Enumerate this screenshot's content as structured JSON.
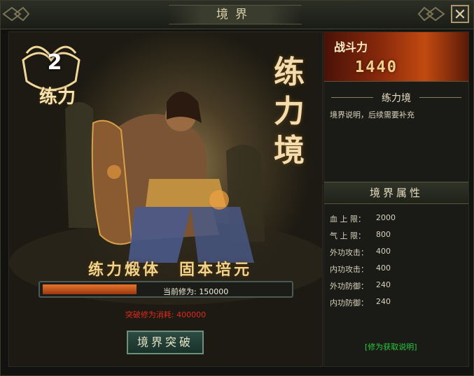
{
  "window": {
    "title": "境界",
    "close": "✕"
  },
  "hero": {
    "level_badge": {
      "number": "2",
      "label": "练力"
    },
    "realm_title": "练力境",
    "slogan": "练力煅体　固本培元",
    "progress": {
      "label": "当前修为: 150000",
      "fraction": 0.38
    },
    "cost_text": "突破修为消耗: 400000",
    "breakthrough_button": "境界突破"
  },
  "side": {
    "power": {
      "label": "战斗力",
      "value": "1440"
    },
    "realm_name": "练力境",
    "realm_description": "境界说明，后续需要补充",
    "attributes_header": "境界属性",
    "attributes": [
      {
        "label": "血 上 限：",
        "value": "2000"
      },
      {
        "label": "气 上 限：",
        "value": "800"
      },
      {
        "label": "外功攻击：",
        "value": "400"
      },
      {
        "label": "内功攻击：",
        "value": "400"
      },
      {
        "label": "外功防御：",
        "value": "240"
      },
      {
        "label": "内功防御：",
        "value": "240"
      }
    ],
    "help_link": "[修为获取说明]"
  }
}
